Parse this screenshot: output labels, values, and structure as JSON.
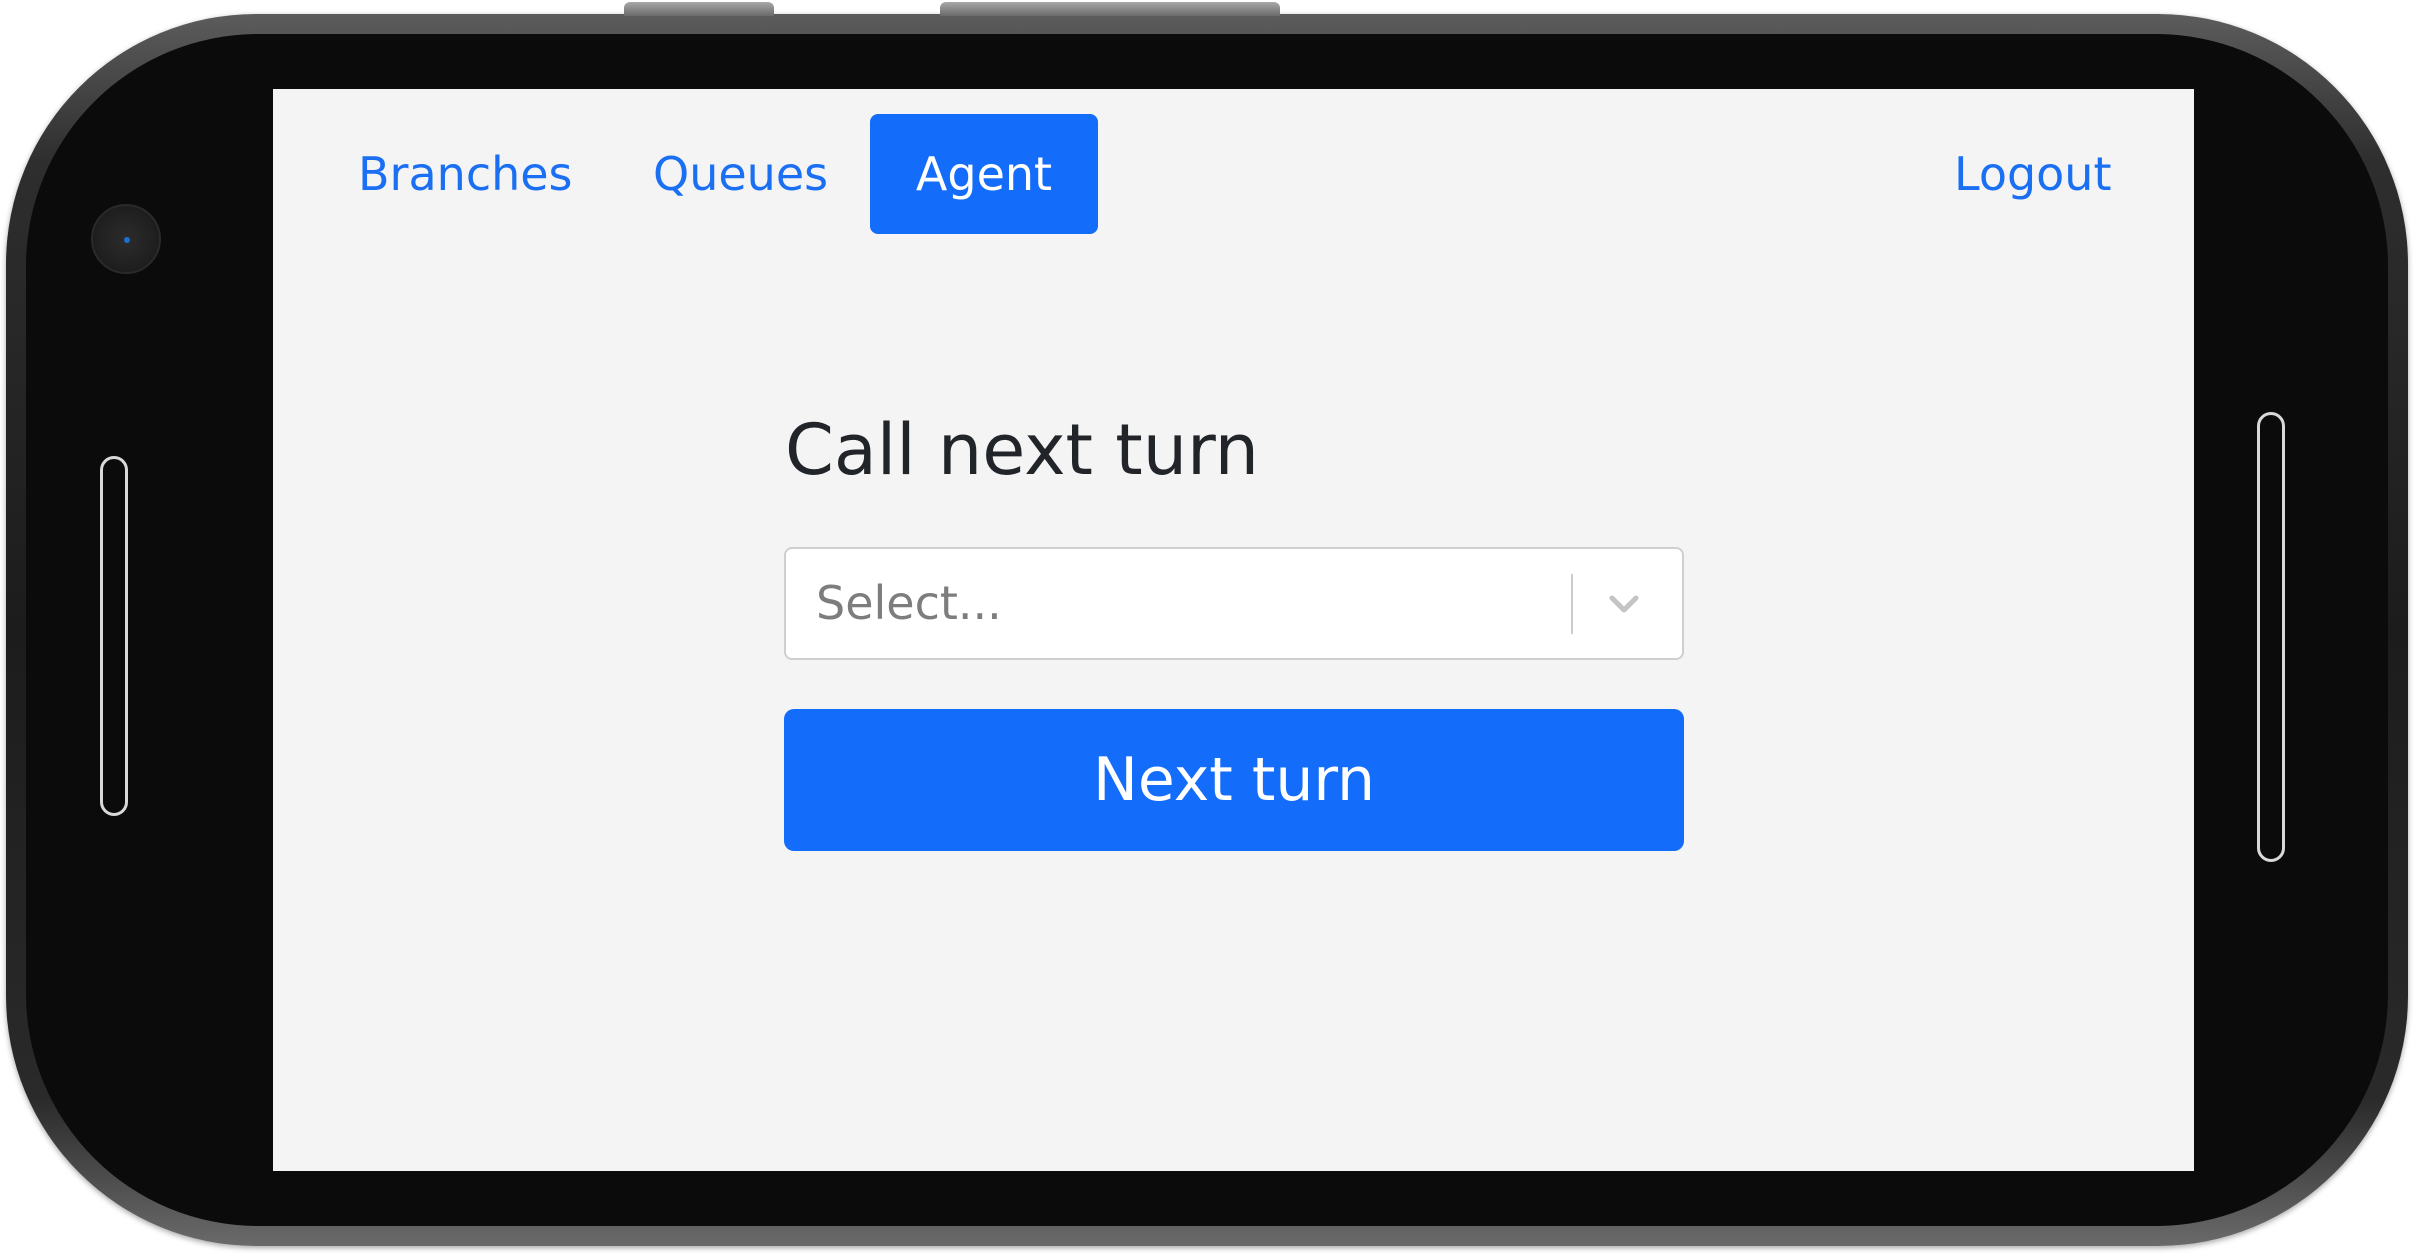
{
  "nav": {
    "items": [
      {
        "label": "Branches",
        "active": false
      },
      {
        "label": "Queues",
        "active": false
      },
      {
        "label": "Agent",
        "active": true
      }
    ],
    "logout_label": "Logout"
  },
  "main": {
    "title": "Call next turn",
    "select": {
      "placeholder": "Select...",
      "icon": "chevron-down-icon"
    },
    "next_button_label": "Next turn"
  },
  "colors": {
    "accent": "#146dfa",
    "link": "#1a6ff2",
    "background": "#f4f4f4",
    "title_text": "#212529",
    "placeholder_text": "#7d7d7d"
  }
}
